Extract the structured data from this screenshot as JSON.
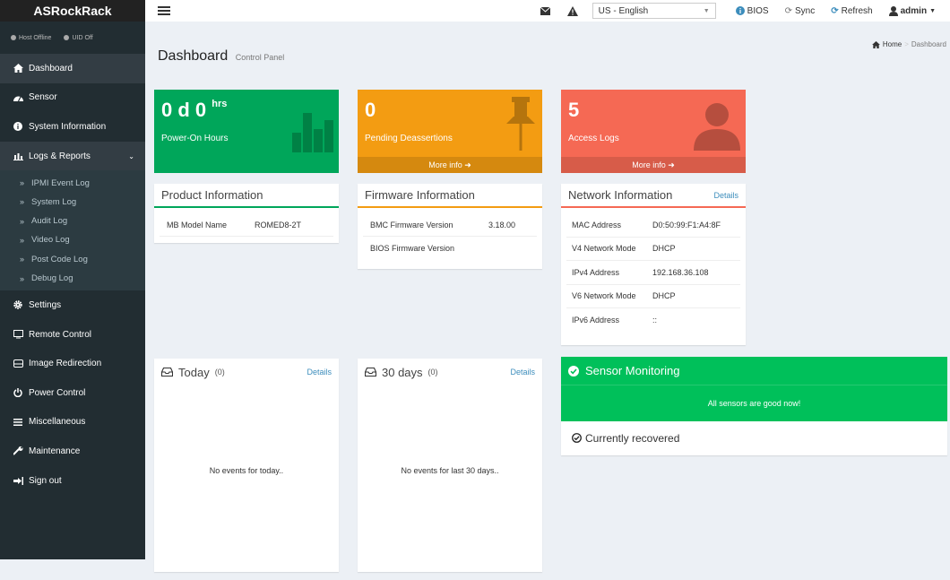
{
  "header": {
    "brand": "ASRockRack",
    "language": "US - English",
    "bios_label": "BIOS",
    "sync_label": "Sync",
    "refresh_label": "Refresh",
    "user_label": "admin"
  },
  "sidebar": {
    "host_status": "Host Offline",
    "uid_status": "UID Off",
    "items": [
      {
        "label": "Dashboard",
        "icon": "dashboard-icon"
      },
      {
        "label": "Sensor",
        "icon": "sensor-icon"
      },
      {
        "label": "System Information",
        "icon": "info-icon"
      },
      {
        "label": "Logs & Reports",
        "icon": "bar-chart-icon"
      },
      {
        "label": "Settings",
        "icon": "gear-icon"
      },
      {
        "label": "Remote Control",
        "icon": "monitor-icon"
      },
      {
        "label": "Image Redirection",
        "icon": "disk-icon"
      },
      {
        "label": "Power Control",
        "icon": "power-icon"
      },
      {
        "label": "Miscellaneous",
        "icon": "list-icon"
      },
      {
        "label": "Maintenance",
        "icon": "wrench-icon"
      },
      {
        "label": "Sign out",
        "icon": "sign-out-icon"
      }
    ],
    "logs_submenu": [
      "IPMI Event Log",
      "System Log",
      "Audit Log",
      "Video Log",
      "Post Code Log",
      "Debug Log"
    ]
  },
  "page": {
    "title": "Dashboard",
    "subtitle": "Control Panel",
    "breadcrumb_home": "Home",
    "breadcrumb_current": "Dashboard"
  },
  "stats": {
    "power_on_days": "0 d 0",
    "power_on_unit": "hrs",
    "power_on_label": "Power-On Hours",
    "pending_value": "0",
    "pending_label": "Pending Deassertions",
    "pending_more": "More info",
    "access_value": "5",
    "access_label": "Access Logs",
    "access_more": "More info"
  },
  "colors": {
    "green": "#00a65a",
    "orange": "#f39c12",
    "red": "#f56954",
    "sidebar": "#222d32",
    "link": "#3c8dbc"
  },
  "product": {
    "title": "Product Information",
    "rows": [
      {
        "label": "MB Model Name",
        "value": "ROMED8-2T"
      }
    ]
  },
  "firmware": {
    "title": "Firmware Information",
    "rows": [
      {
        "label": "BMC Firmware Version",
        "value": "3.18.00"
      },
      {
        "label": "BIOS Firmware Version",
        "value": ""
      }
    ]
  },
  "network": {
    "title": "Network Information",
    "details": "Details",
    "rows": [
      {
        "label": "MAC Address",
        "value": "D0:50:99:F1:A4:8F"
      },
      {
        "label": "V4 Network Mode",
        "value": "DHCP"
      },
      {
        "label": "IPv4 Address",
        "value": "192.168.36.108"
      },
      {
        "label": "V6 Network Mode",
        "value": "DHCP"
      },
      {
        "label": "IPv6 Address",
        "value": "::"
      }
    ]
  },
  "today": {
    "title": "Today",
    "count": "(0)",
    "details": "Details",
    "empty": "No events for today.."
  },
  "month": {
    "title": "30 days",
    "count": "(0)",
    "details": "Details",
    "empty": "No events for last 30 days.."
  },
  "sensor": {
    "title": "Sensor Monitoring",
    "status": "All sensors are good now!",
    "recovered": "Currently recovered"
  }
}
